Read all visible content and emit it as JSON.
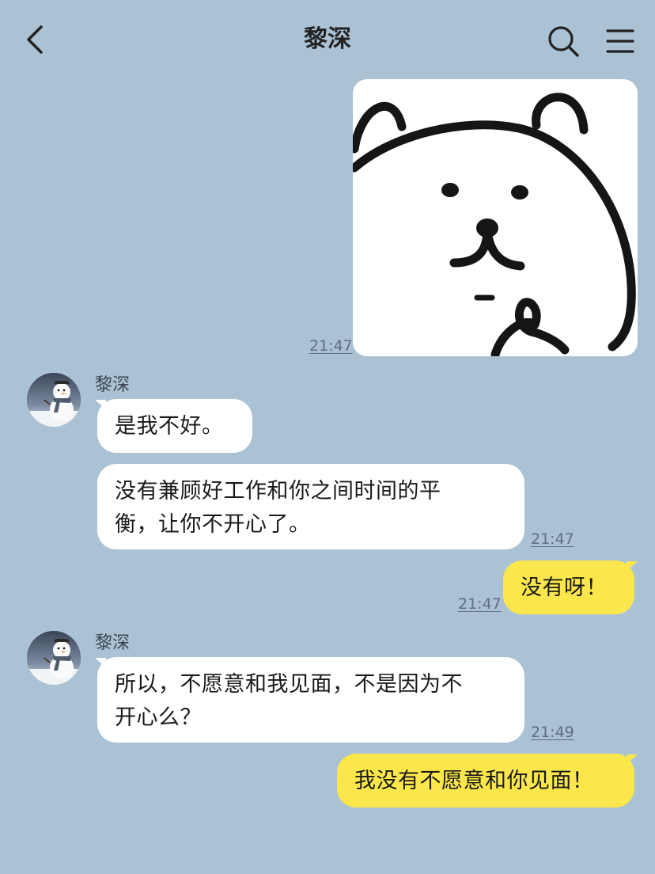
{
  "header": {
    "title": "黎深"
  },
  "icons": {
    "back": "chevron-left-icon",
    "search": "search-icon",
    "menu": "hamburger-menu-icon"
  },
  "colors": {
    "background": "#abc1d4",
    "incoming_bubble": "#ffffff",
    "outgoing_bubble": "#fbe74b",
    "timestamp": "#5f6f80"
  },
  "messages": [
    {
      "direction": "out",
      "type": "image",
      "image": "white bear sticker",
      "time": "21:47"
    },
    {
      "direction": "in",
      "sender": "黎深",
      "text": "是我不好。"
    },
    {
      "direction": "in",
      "text_lines": [
        "没有兼顾好工作和你之间时间的平",
        "衡，让你不开心了。"
      ],
      "time": "21:47"
    },
    {
      "direction": "out",
      "text": "没有呀！",
      "time": "21:47"
    },
    {
      "direction": "in",
      "sender": "黎深",
      "text_lines": [
        "所以，不愿意和我见面，不是因为不",
        "开心么？"
      ],
      "time": "21:49"
    },
    {
      "direction": "out",
      "text": "我没有不愿意和你见面！"
    }
  ]
}
